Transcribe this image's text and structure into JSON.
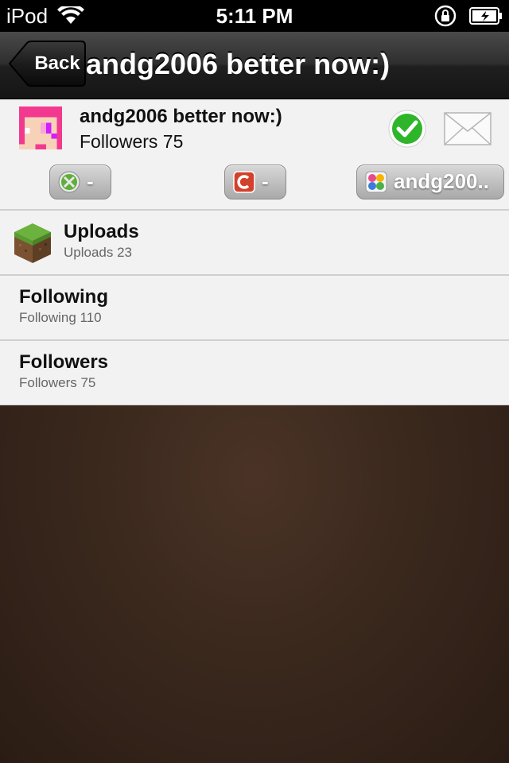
{
  "status_bar": {
    "carrier": "iPod",
    "time": "5:11 PM"
  },
  "nav": {
    "back_label": "Back",
    "title": "andg2006 better now:)"
  },
  "profile": {
    "name": "andg2006 better now:)",
    "followers_text": "Followers 75",
    "badges": [
      {
        "icon": "xbox-icon",
        "label": "-"
      },
      {
        "icon": "game-icon",
        "label": "-"
      },
      {
        "icon": "game-center-icon",
        "label": "andg200.."
      }
    ]
  },
  "list": [
    {
      "title": "Uploads",
      "subtitle": "Uploads 23",
      "icon": "grass-block-icon"
    },
    {
      "title": "Following",
      "subtitle": "Following 110"
    },
    {
      "title": "Followers",
      "subtitle": "Followers 75"
    }
  ],
  "colors": {
    "nav_bg": "#2e2e2e",
    "list_bg": "#f2f2f2",
    "leather": "#3a281d",
    "check_green": "#2fb52a"
  }
}
